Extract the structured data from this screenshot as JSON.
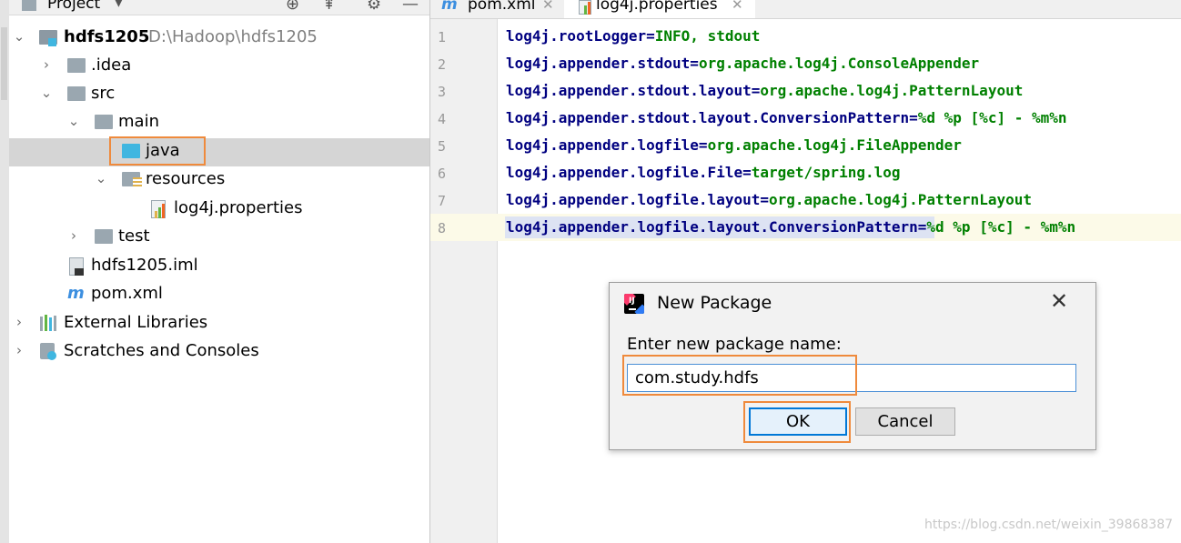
{
  "project_panel": {
    "header_title": "Project",
    "tree": [
      {
        "label": "hdfs1205",
        "path": "D:\\Hadoop\\hdfs1205"
      },
      {
        "label": ".idea"
      },
      {
        "label": "src"
      },
      {
        "label": "main"
      },
      {
        "label": "java"
      },
      {
        "label": "resources"
      },
      {
        "label": "log4j.properties"
      },
      {
        "label": "test"
      },
      {
        "label": "hdfs1205.iml"
      },
      {
        "label": "pom.xml"
      },
      {
        "label": "External Libraries"
      },
      {
        "label": "Scratches and Consoles"
      }
    ]
  },
  "editor": {
    "tabs": [
      {
        "label": "pom.xml",
        "icon": "maven-icon"
      },
      {
        "label": "log4j.properties",
        "icon": "properties-icon",
        "active": true
      }
    ],
    "lines": [
      {
        "num": "1",
        "key": "log4j.rootLogger",
        "eq": "=",
        "value": "INFO, stdout"
      },
      {
        "num": "2",
        "key": "log4j.appender.stdout",
        "eq": "=",
        "value": "org.apache.log4j.ConsoleAppender"
      },
      {
        "num": "3",
        "key": "log4j.appender.stdout.layout",
        "eq": "=",
        "value": "org.apache.log4j.PatternLayout"
      },
      {
        "num": "4",
        "key": "log4j.appender.stdout.layout.ConversionPattern",
        "eq": "=",
        "value": "%d %p [%c] - %m%n"
      },
      {
        "num": "5",
        "key": "log4j.appender.logfile",
        "eq": "=",
        "value": "org.apache.log4j.FileAppender"
      },
      {
        "num": "6",
        "key": "log4j.appender.logfile.File",
        "eq": "=",
        "value": "target/spring.log"
      },
      {
        "num": "7",
        "key": "log4j.appender.logfile.layout",
        "eq": "=",
        "value": "org.apache.log4j.PatternLayout"
      },
      {
        "num": "8",
        "key": "log4j.appender.logfile.layout.ConversionPattern",
        "eq": "=",
        "value": "%d %p [%c] - %m%n"
      }
    ]
  },
  "dialog": {
    "title": "New Package",
    "prompt": "Enter new package name:",
    "input_value": "com.study.hdfs",
    "ok_label": "OK",
    "cancel_label": "Cancel",
    "close_glyph": "✕"
  },
  "watermark": "https://blog.csdn.net/weixin_39868387",
  "colors": {
    "highlight_box": "#ef8a3c",
    "folder_source": "#40b6e0",
    "folder_plain": "#9aa7b0",
    "key_color": "#000080",
    "value_color": "#008000"
  }
}
